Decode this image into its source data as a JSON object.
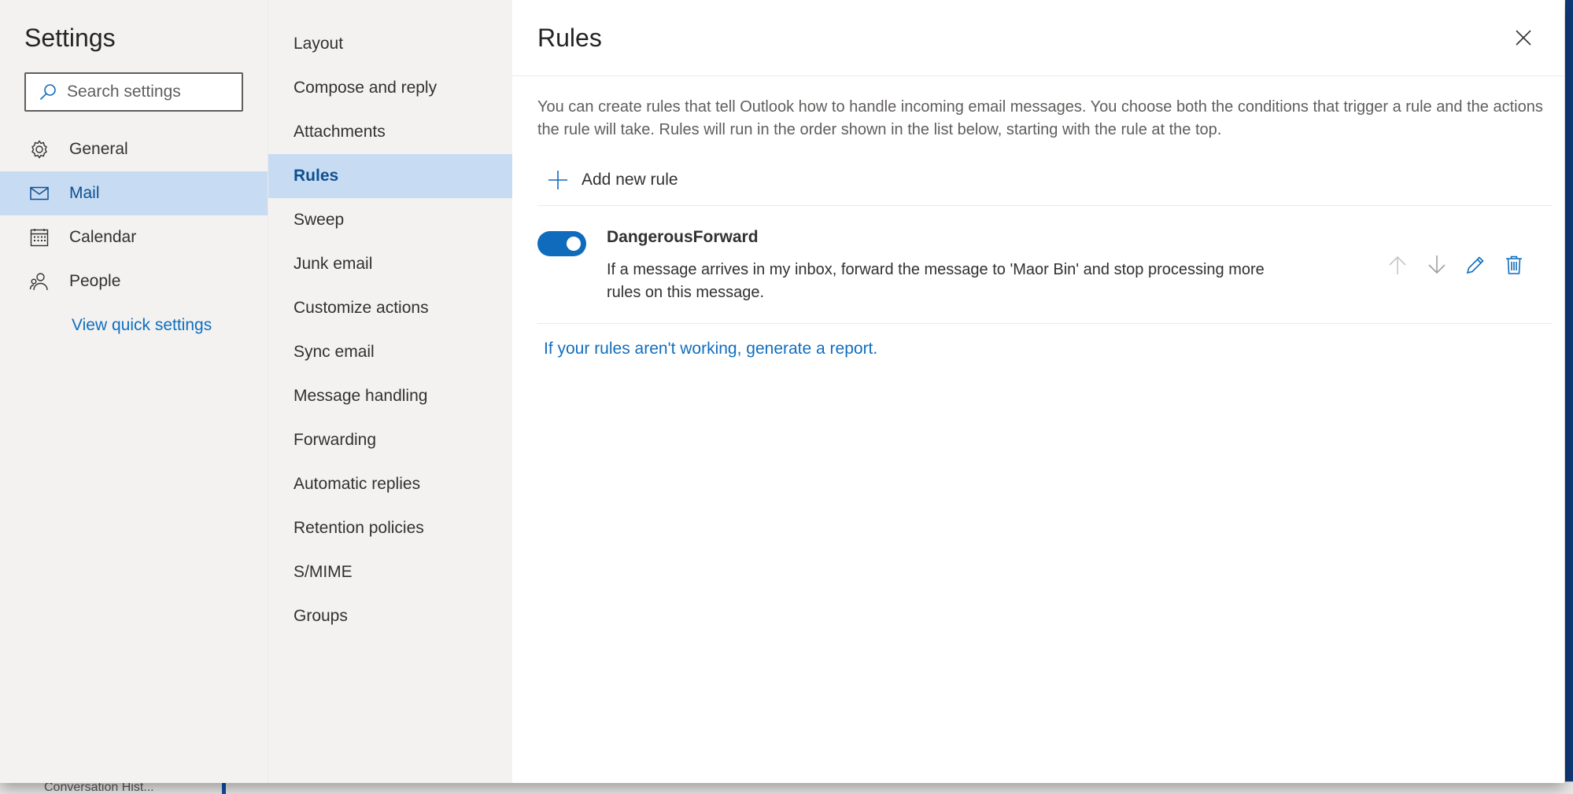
{
  "background": {
    "bottom_text": "Conversation Hist..."
  },
  "settings": {
    "title": "Settings",
    "search_placeholder": "Search settings",
    "categories": [
      {
        "label": "General",
        "icon": "gear-icon"
      },
      {
        "label": "Mail",
        "icon": "mail-icon"
      },
      {
        "label": "Calendar",
        "icon": "calendar-icon"
      },
      {
        "label": "People",
        "icon": "people-icon"
      }
    ],
    "quick_settings_link": "View quick settings"
  },
  "mail_nav": {
    "items": [
      "Layout",
      "Compose and reply",
      "Attachments",
      "Rules",
      "Sweep",
      "Junk email",
      "Customize actions",
      "Sync email",
      "Message handling",
      "Forwarding",
      "Automatic replies",
      "Retention policies",
      "S/MIME",
      "Groups"
    ],
    "active": "Rules"
  },
  "rules_panel": {
    "title": "Rules",
    "description": "You can create rules that tell Outlook how to handle incoming email messages. You choose both the conditions that trigger a rule and the actions the rule will take. Rules will run in the order shown in the list below, starting with the rule at the top.",
    "add_rule_label": "Add new rule",
    "rules": [
      {
        "name": "DangerousForward",
        "enabled": true,
        "description": "If a message arrives in my inbox, forward the message to 'Maor Bin' and stop processing more rules on this message."
      }
    ],
    "report_link": "If your rules aren't working, generate a report."
  },
  "colors": {
    "accent": "#0f6cbd",
    "link": "#106ebe",
    "selected_bg": "#c7dcf2",
    "nav_bg": "#f3f2f1"
  }
}
